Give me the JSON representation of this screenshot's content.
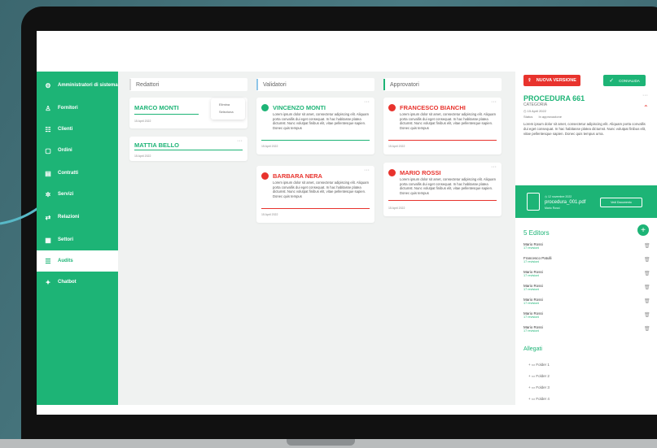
{
  "sidebar": {
    "items": [
      {
        "label": "Amministratori di sistema",
        "icon": "users-cog-icon"
      },
      {
        "label": "Fornitori",
        "icon": "user-icon"
      },
      {
        "label": "Clienti",
        "icon": "group-icon"
      },
      {
        "label": "Ordini",
        "icon": "cart-icon"
      },
      {
        "label": "Contratti",
        "icon": "document-icon"
      },
      {
        "label": "Servizi",
        "icon": "gears-icon"
      },
      {
        "label": "Relazioni",
        "icon": "link-icon"
      },
      {
        "label": "Settori",
        "icon": "building-icon"
      },
      {
        "label": "Audits",
        "icon": "audit-icon"
      },
      {
        "label": "Chatbot",
        "icon": "chat-icon"
      }
    ],
    "active_index": 8
  },
  "columns": {
    "redattori": {
      "title": "Redattori",
      "cards": [
        {
          "name": "MARCO MONTI",
          "date": "15 April 2022"
        },
        {
          "name": "MATTIA BELLO",
          "date": "15 April 2022"
        }
      ],
      "menu": {
        "item1": "Elimina",
        "item2": "Seleziona"
      }
    },
    "validatori": {
      "title": "Validatori",
      "cards": [
        {
          "name": "VINCENZO MONTI",
          "text": "Lorem ipsum dolor sit amet, consectetur adipiscing elit. Aliquam porta convallis dui eget consequat. In hac habitasse platea dictumst. Nunc volutpat finibus elit, vitae pellentesque sapien. Donec quis tempus",
          "date": "15 April 2022"
        },
        {
          "name": "BARBARA NERA",
          "text": "Lorem ipsum dolor sit amet, consectetur adipiscing elit. Aliquam porta convallis dui eget consequat. In hac habitasse platea dictumst. Nunc volutpat finibus elit, vitae pellentesque sapien. Donec quis tempus",
          "date": "15 April 2022"
        }
      ]
    },
    "approvatori": {
      "title": "Approvatori",
      "cards": [
        {
          "name": "FRANCESCO BIANCHI",
          "text": "Lorem ipsum dolor sit amet, consectetur adipiscing elit. Aliquam porta convallis dui eget consequat. In hac habitasse platea dictumst. Nunc volutpat finibus elit, vitae pellentesque sapien. Donec quis tempus",
          "date": "15 April 2022"
        },
        {
          "name": "MARIO ROSSI",
          "text": "Lorem ipsum dolor sit amet, consectetur adipiscing elit. Aliquam porta convallis dui eget consequat. In hac habitasse platea dictumst. Nunc volutpat finibus elit, vitae pellentesque sapien. Donec quis tempus",
          "date": "15 April 2022"
        }
      ]
    }
  },
  "panel": {
    "new_version_label": "NUOVA VERSIONE",
    "approve_label": "CONVALIDA",
    "procedure_title": "PROCEDURA 661",
    "category": "CATEGORIA",
    "date": "15 April 2022",
    "status_label": "Status",
    "status_value": "In approvazione",
    "description": "Lorem ipsum dolor sit amet, consectetur adipiscing elit. Aliquam porta convallis dui eget consequat. In hac habitasse platea dictumst. Nunc volutpat finibus elit, vitae pellentesque sapien. Donec quis tempus urna.",
    "file_date": "12 novembre 2022",
    "file_name": "procedura_001.pdf",
    "file_author": "Mario Rossi",
    "file_button": "Vedi Documento",
    "editors_title": "5 Editors",
    "editors": [
      {
        "name": "Mario Rossi",
        "revisions": "17 revisioni"
      },
      {
        "name": "Francesco Patulli",
        "revisions": "17 revisioni"
      },
      {
        "name": "Mario Rossi",
        "revisions": "17 revisioni"
      },
      {
        "name": "Mario Rossi",
        "revisions": "17 revisioni"
      },
      {
        "name": "Mario Rossi",
        "revisions": "17 revisioni"
      },
      {
        "name": "Mario Rossi",
        "revisions": "17 revisioni"
      },
      {
        "name": "Mario Rossi",
        "revisions": "17 revisioni"
      }
    ],
    "attachments_title": "Allegati",
    "folders": [
      "Folder 1",
      "Folder 2",
      "Folder 3",
      "Folder 4"
    ]
  },
  "colors": {
    "brand": "#1db476",
    "danger": "#e8332d",
    "validator_bar": "#8ec5e8",
    "approver_bar": "#1db476"
  }
}
